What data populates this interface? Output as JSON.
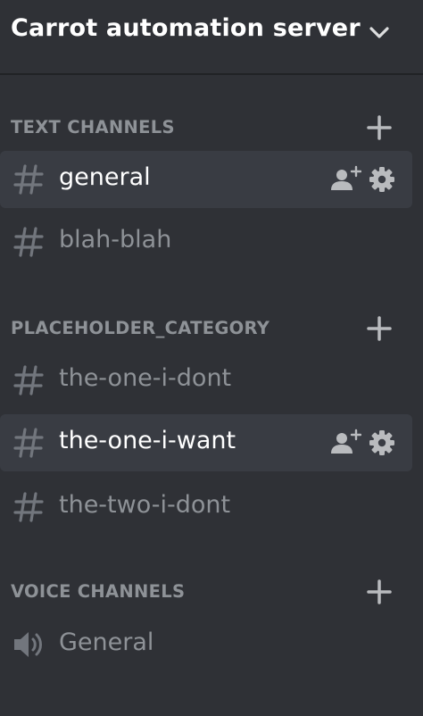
{
  "server": {
    "name": "Carrot automation server"
  },
  "categories": [
    {
      "label": "TEXT CHANNELS",
      "channels": [
        {
          "name": "general",
          "type": "text",
          "active": true
        },
        {
          "name": "blah-blah",
          "type": "text",
          "active": false
        }
      ]
    },
    {
      "label": "PLACEHOLDER_CATEGORY",
      "channels": [
        {
          "name": "the-one-i-dont",
          "type": "text",
          "active": false
        },
        {
          "name": "the-one-i-want",
          "type": "text",
          "active": true
        },
        {
          "name": "the-two-i-dont",
          "type": "text",
          "active": false
        }
      ]
    },
    {
      "label": "VOICE CHANNELS",
      "channels": [
        {
          "name": "General",
          "type": "voice",
          "active": false
        }
      ]
    }
  ],
  "colors": {
    "sidebar_bg": "#2f3136",
    "active_bg": "#393c43",
    "muted_text": "#8e9297",
    "active_text": "#ffffff",
    "icon": "#b9bbbe",
    "muted_icon": "#72767d"
  },
  "icons": {
    "header": "chevron-down-icon",
    "category_action": "plus-icon",
    "text_channel": "hash-icon",
    "voice_channel": "speaker-icon",
    "invite": "add-user-icon",
    "settings": "gear-icon"
  }
}
